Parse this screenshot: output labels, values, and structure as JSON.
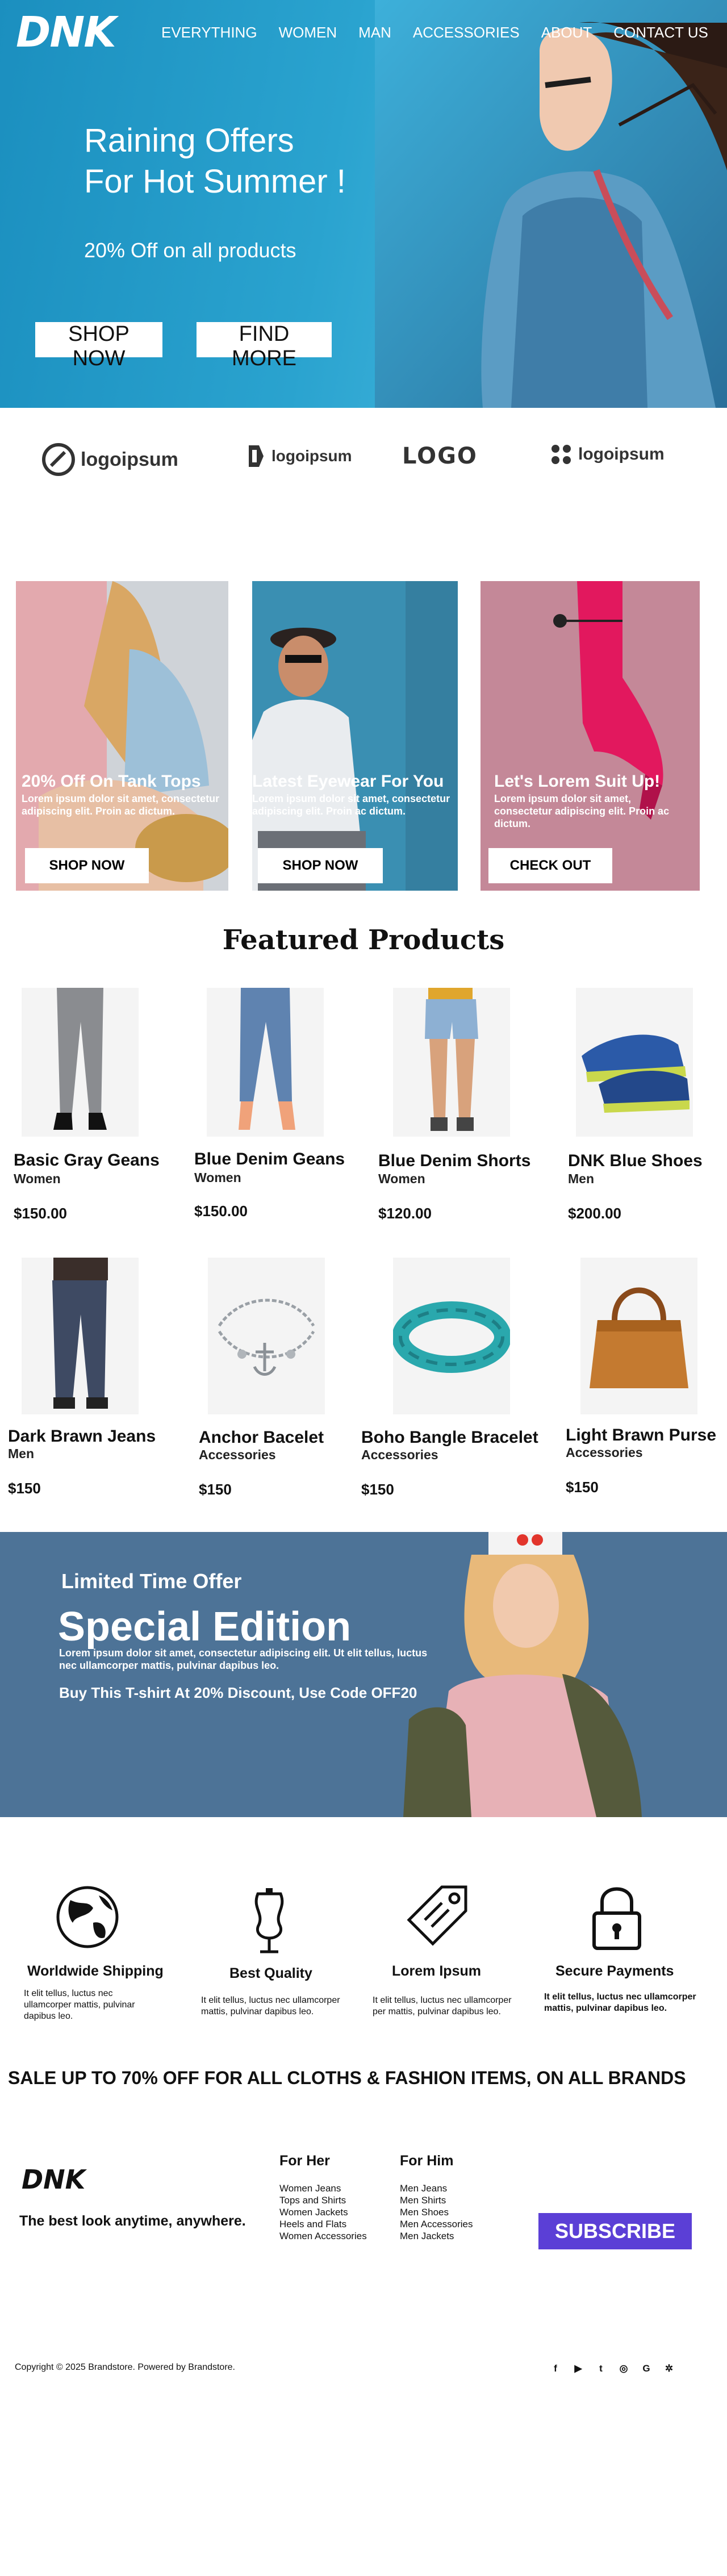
{
  "brand": {
    "name": "DNK"
  },
  "nav": {
    "items": [
      "EVERYTHING",
      "WOMEN",
      "MAN",
      "ACCESSORIES",
      "ABOUT",
      "CONTACT US"
    ]
  },
  "hero": {
    "title_line1": "Raining Offers",
    "title_line2": "For Hot Summer !",
    "subtitle": "20% Off on all products",
    "shop_now": "SHOP NOW",
    "find_more": "FIND MORE"
  },
  "partner_logos": [
    "logoipsum",
    "logoipsum",
    "LOGO",
    "logoipsum"
  ],
  "promos": [
    {
      "title": "20% Off On Tank Tops",
      "text": "Lorem ipsum dolor sit amet, consectetur adipiscing elit. Proin ac dictum.",
      "button": "SHOP NOW"
    },
    {
      "title": "Latest Eyewear For You",
      "text": "Lorem ipsum dolor sit amet, consectetur adipiscing elit. Proin ac dictum.",
      "button": "SHOP NOW"
    },
    {
      "title": "Let's Lorem Suit Up!",
      "text": "Lorem ipsum dolor sit amet, consectetur adipiscing elit. Proin ac dictum.",
      "button": "CHECK OUT"
    }
  ],
  "featured_title": "Featured Products",
  "products": [
    {
      "name": "Basic Gray Geans",
      "category": "Women",
      "price": "$150.00"
    },
    {
      "name": "Blue Denim Geans",
      "category": "Women",
      "price": "$150.00"
    },
    {
      "name": "Blue Denim Shorts",
      "category": "Women",
      "price": "$120.00"
    },
    {
      "name": "DNK Blue Shoes",
      "category": "Men",
      "price": "$200.00"
    },
    {
      "name": "Dark Brawn Jeans",
      "category": "Men",
      "price": "$150"
    },
    {
      "name": "Anchor Bacelet",
      "category": "Accessories",
      "price": "$150"
    },
    {
      "name": "Boho Bangle Bracelet",
      "category": "Accessories",
      "price": "$150"
    },
    {
      "name": "Light Brawn Purse",
      "category": "Accessories",
      "price": "$150"
    }
  ],
  "special": {
    "label": "Limited Time Offer",
    "title": "Special Edition",
    "text": "Lorem ipsum dolor sit amet, consectetur adipiscing elit. Ut elit tellus, luctus nec ullamcorper mattis, pulvinar dapibus leo.",
    "code": "Buy This T-shirt At 20% Discount, Use Code OFF20"
  },
  "features": [
    {
      "icon": "globe-icon",
      "title": "Worldwide Shipping",
      "text": "It elit tellus, luctus nec ullamcorper mattis, pulvinar dapibus leo."
    },
    {
      "icon": "mannequin-icon",
      "title": "Best Quality",
      "text": "It elit tellus, luctus nec ullamcorper mattis, pulvinar dapibus leo."
    },
    {
      "icon": "price-tag-icon",
      "title": "Lorem Ipsum",
      "text": "It elit tellus, luctus nec ullamcorper per mattis, pulvinar dapibus leo."
    },
    {
      "icon": "padlock-icon",
      "title": "Secure Payments",
      "text": "It elit tellus, luctus nec ullamcorper mattis, pulvinar dapibus leo."
    }
  ],
  "sale_banner": "SALE UP TO 70% OFF FOR ALL CLOTHS & FASHION ITEMS, ON ALL BRANDS",
  "footer": {
    "logo": "DNK",
    "tagline": "The best look anytime, anywhere.",
    "for_her_title": "For Her",
    "for_her": [
      "Women Jeans",
      "Tops and Shirts",
      "Women Jackets",
      "Heels and Flats",
      "Women Accessories"
    ],
    "for_him_title": "For Him",
    "for_him": [
      "Men Jeans",
      "Men Shirts",
      "Men Shoes",
      "Men Accessories",
      "Men Jackets"
    ],
    "subscribe": "SUBSCRIBE",
    "copyright": "Copyright © 2025 Brandstore. Powered by Brandstore.",
    "socials": [
      "f",
      "▶",
      "t",
      "◎",
      "G",
      "✲"
    ]
  },
  "colors": {
    "hero_blue": "#2aa3cf",
    "special_bg": "#4d7397",
    "subscribe": "#5b3fd6"
  }
}
